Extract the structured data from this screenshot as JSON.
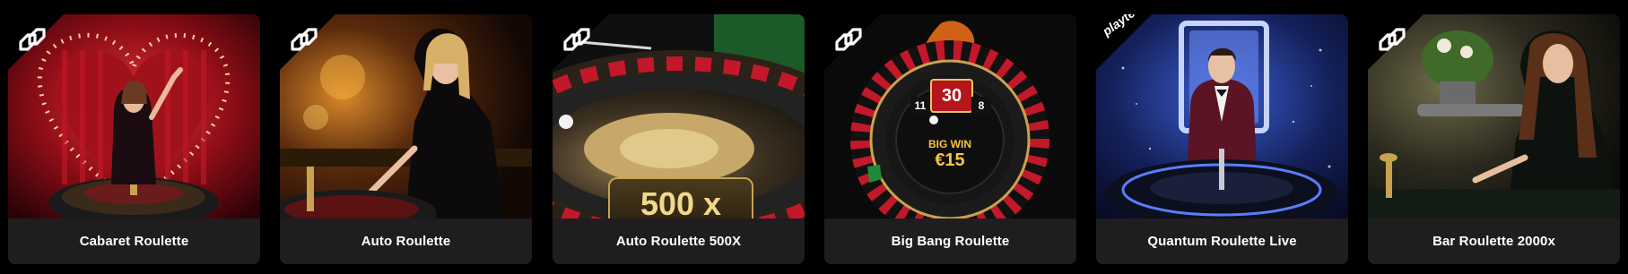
{
  "games": [
    {
      "title": "Cabaret Roulette",
      "provider_icon": "infinity-link-icon"
    },
    {
      "title": "Auto Roulette",
      "provider_icon": "infinity-link-icon"
    },
    {
      "title": "Auto Roulette 500X",
      "provider_icon": "infinity-link-icon",
      "badge": "500 x"
    },
    {
      "title": "Big Bang Roulette",
      "provider_icon": "infinity-link-icon",
      "win_label": "BIG WIN",
      "win_amount": "€15",
      "numbers": [
        "11",
        "30",
        "8"
      ]
    },
    {
      "title": "Quantum Roulette Live",
      "provider_icon": "playtech-logo",
      "provider_text": "playtech"
    },
    {
      "title": "Bar Roulette 2000x",
      "provider_icon": "infinity-link-icon"
    }
  ],
  "colors": {
    "background": "#000000",
    "card_caption": "#1f1d1f",
    "caption_text": "#ffffff",
    "accent_red": "#b5161b",
    "accent_gold": "#c9a24f"
  }
}
